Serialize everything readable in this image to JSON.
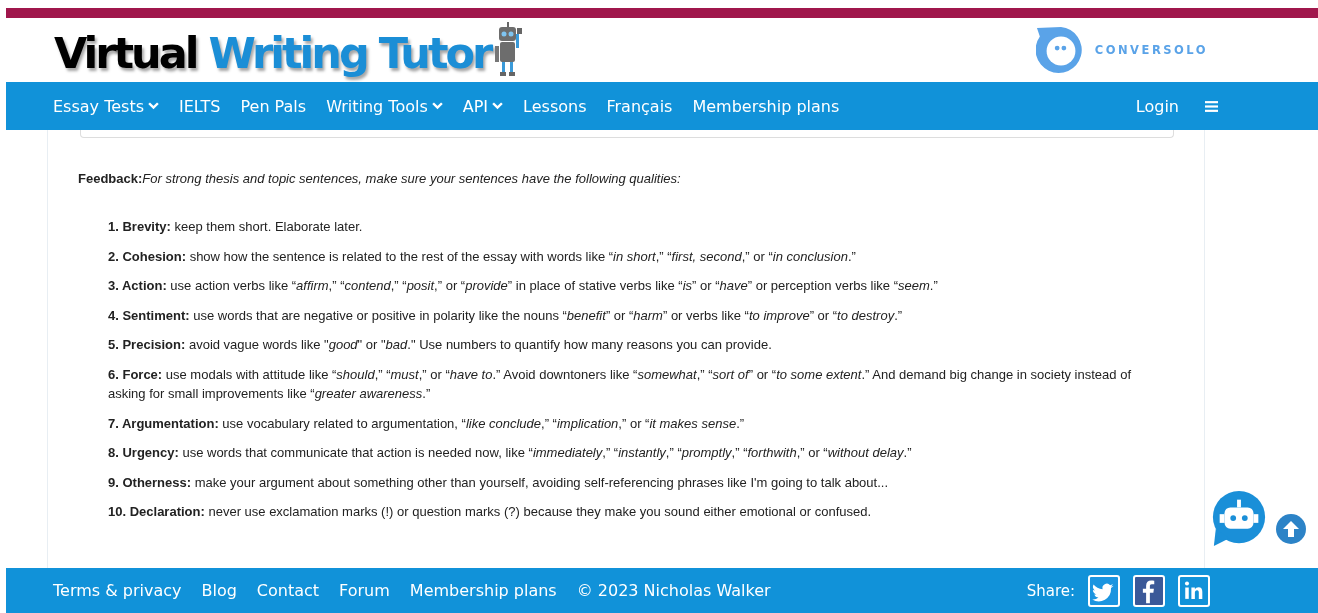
{
  "header": {
    "logo": {
      "first": "Virtual",
      "second": "Writing Tutor"
    },
    "partner": "CONVERSOLO"
  },
  "nav": {
    "items": [
      {
        "label": "Essay Tests",
        "has_menu": true
      },
      {
        "label": "IELTS",
        "has_menu": false
      },
      {
        "label": "Pen Pals",
        "has_menu": false
      },
      {
        "label": "Writing Tools",
        "has_menu": true
      },
      {
        "label": "API",
        "has_menu": true
      },
      {
        "label": "Lessons",
        "has_menu": false
      },
      {
        "label": "Français",
        "has_menu": false
      },
      {
        "label": "Membership plans",
        "has_menu": false
      }
    ],
    "login": "Login"
  },
  "feedback": {
    "label": "Feedback:",
    "intro": "For strong thesis and topic sentences, make sure your sentences have the following qualities:",
    "items": [
      "**1. Brevity:** keep them short. Elaborate later.",
      "**2. Cohesion:** show how the sentence is related to the rest of the essay with words like “*in short*,” “*first, second*,” or “*in conclusion*.”",
      "**3. Action:** use action verbs like “*affirm*,” “*contend*,” “*posit*,” or “*provide*” in place of stative verbs like “*is*” or “*have*” or perception verbs like “*seem*.”",
      "**4. Sentiment:** use words that are negative or positive in polarity like the nouns “*benefit*” or “*harm*” or verbs like “*to improve*” or “*to destroy*.”",
      "**5. Precision:** avoid vague words like \"*good*\" or \"*bad*.\" Use numbers to quantify how many reasons you can provide.",
      "**6. Force:** use modals with attitude like “*should*,” “*must*,” or “*have to*.” Avoid downtoners like “*somewhat*,” “*sort of*” or “*to some extent*.” And demand big change in society instead of asking for small improvements like “*greater awareness*.”",
      "**7. Argumentation:** use vocabulary related to argumentation, “*like conclude*,” “*implication*,” or “*it makes sense*.”",
      "**8. Urgency:** use words that communicate that action is needed now, like “*immediately*,” “*instantly*,” “*promptly*,” “*forthwith*,” or “*without delay*.”",
      "**9. Otherness:** make your argument about something other than yourself, avoiding self-referencing phrases like I'm going to talk about...",
      "**10. Declaration:** never use exclamation marks (!) or question marks (?) because they make you sound either emotional or confused."
    ]
  },
  "footer": {
    "links": [
      "Terms & privacy",
      "Blog",
      "Contact",
      "Forum",
      "Membership plans"
    ],
    "copyright": "© 2023 Nicholas Walker",
    "share_label": "Share:",
    "share": [
      {
        "kind": "twitter"
      },
      {
        "kind": "facebook"
      },
      {
        "kind": "linkedin"
      }
    ]
  }
}
